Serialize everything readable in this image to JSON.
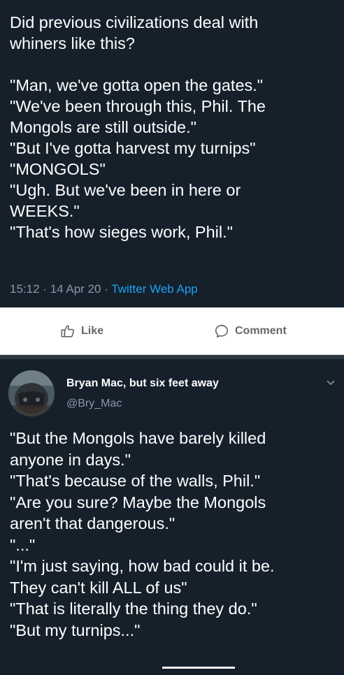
{
  "tweet": {
    "lines": [
      "Did previous civilizations deal with",
      "whiners like this?",
      "",
      "\"Man, we've gotta open the gates.\"",
      "\"We've been through this, Phil. The",
      "Mongols are still outside.\"",
      "\"But I've gotta harvest my turnips\"",
      "\"MONGOLS\"",
      "\"Ugh. But we've been in here or",
      "WEEKS.\"",
      "\"That's how sieges work, Phil.\""
    ],
    "time": "15:12",
    "date": "14 Apr 20",
    "separator": "·",
    "app": "Twitter Web App"
  },
  "actions": {
    "like_label": "Like",
    "comment_label": "Comment",
    "like_icon": "thumbs-up-icon",
    "comment_icon": "speech-bubble-icon"
  },
  "reply": {
    "name": "Bryan Mac, but six feet away",
    "handle": "@Bry_Mac",
    "lines": [
      "\"But the Mongols have barely killed",
      "anyone in days.\"",
      "\"That's because of the walls, Phil.\"",
      "\"Are you sure? Maybe the Mongols",
      "aren't that dangerous.\"",
      "\"...\"",
      "\"I'm just saying, how bad could it be.",
      "They can't kill ALL of us\"",
      "\"That is literally the thing they do.\"",
      "\"But my turnips...\""
    ]
  },
  "colors": {
    "background": "#15202b",
    "text": "#ffffff",
    "secondary": "#8899a6",
    "link": "#1da1f2",
    "action_bar": "#ffffff"
  }
}
